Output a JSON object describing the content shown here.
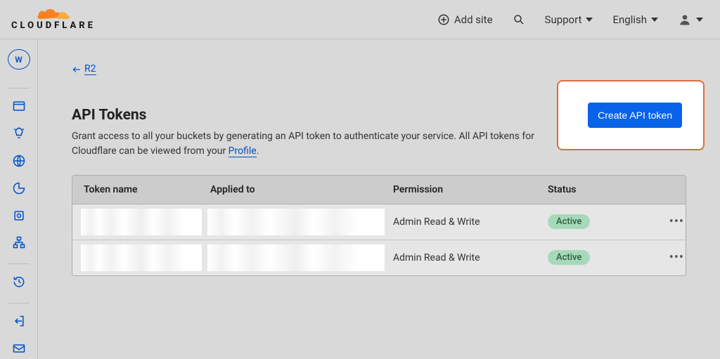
{
  "brand": {
    "name": "CLOUDFLARE"
  },
  "topbar": {
    "add_site_label": "Add site",
    "support_label": "Support",
    "language_label": "English"
  },
  "sidebar": {
    "account_initial": "W"
  },
  "breadcrumb": {
    "back_label": "R2"
  },
  "page": {
    "title": "API Tokens",
    "description_prefix": "Grant access to all your buckets by generating an API token to authenticate your service. All API tokens for Cloudflare can be viewed from your ",
    "profile_link_label": "Profile",
    "description_suffix": "."
  },
  "cta": {
    "create_label": "Create API token"
  },
  "table": {
    "headers": {
      "token_name": "Token name",
      "applied_to": "Applied to",
      "permission": "Permission",
      "status": "Status"
    },
    "rows": [
      {
        "permission": "Admin Read & Write",
        "status": "Active"
      },
      {
        "permission": "Admin Read & Write",
        "status": "Active"
      }
    ]
  }
}
